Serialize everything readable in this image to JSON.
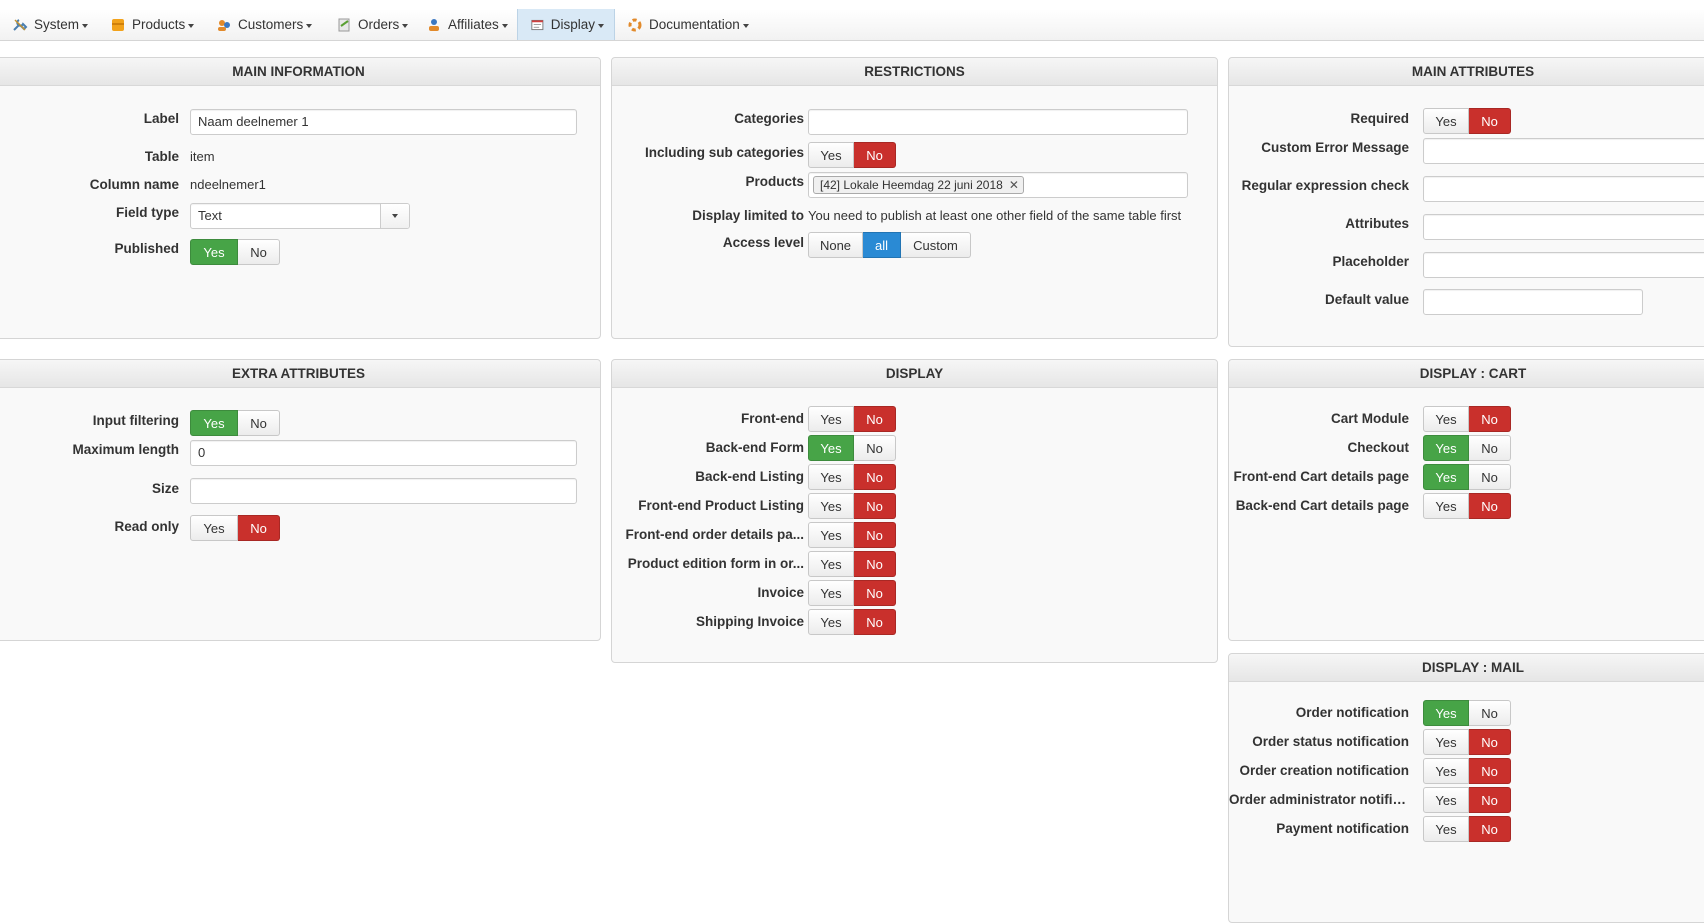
{
  "menu": [
    {
      "label": "System",
      "icon": "wrench-icon",
      "active": false
    },
    {
      "label": "Products",
      "icon": "products-icon",
      "active": false
    },
    {
      "label": "Customers",
      "icon": "customers-icon",
      "active": false
    },
    {
      "label": "Orders",
      "icon": "orders-icon",
      "active": false
    },
    {
      "label": "Affiliates",
      "icon": "affiliates-icon",
      "active": false
    },
    {
      "label": "Display",
      "icon": "display-icon",
      "active": true
    },
    {
      "label": "Documentation",
      "icon": "documentation-icon",
      "active": false
    }
  ],
  "main_info": {
    "title": "MAIN INFORMATION",
    "label_label": "Label",
    "label_value": "Naam deelnemer 1",
    "table_label": "Table",
    "table_value": "item",
    "column_label": "Column name",
    "column_value": "ndeelnemer1",
    "fieldtype_label": "Field type",
    "fieldtype_value": "Text",
    "published_label": "Published",
    "published_value": "Yes"
  },
  "restrictions": {
    "title": "RESTRICTIONS",
    "categories_label": "Categories",
    "categories_value": "",
    "subcat_label": "Including sub categories",
    "subcat_value": "No",
    "products_label": "Products",
    "products_tag": "[42] Lokale Heemdag 22 juni 2018",
    "display_limited_label": "Display limited to",
    "display_limited_value": "You need to publish at least one other field of the same table first",
    "access_label": "Access level",
    "access_options": [
      "None",
      "all",
      "Custom"
    ],
    "access_value": "all"
  },
  "main_attributes": {
    "title": "MAIN ATTRIBUTES",
    "required_label": "Required",
    "required_value": "No",
    "custom_error_label": "Custom Error Message",
    "regex_label": "Regular expression check",
    "attributes_label": "Attributes",
    "placeholder_label": "Placeholder",
    "default_label": "Default value"
  },
  "extra_attributes": {
    "title": "EXTRA ATTRIBUTES",
    "input_filtering_label": "Input filtering",
    "input_filtering_value": "Yes",
    "max_length_label": "Maximum length",
    "max_length_value": "0",
    "size_label": "Size",
    "size_value": "",
    "read_only_label": "Read only",
    "read_only_value": "No"
  },
  "display": {
    "title": "DISPLAY",
    "rows": [
      {
        "label": "Front-end",
        "value": "No"
      },
      {
        "label": "Back-end Form",
        "value": "Yes"
      },
      {
        "label": "Back-end Listing",
        "value": "No"
      },
      {
        "label": "Front-end Product Listing",
        "value": "No"
      },
      {
        "label": "Front-end order details pa...",
        "value": "No"
      },
      {
        "label": "Product edition form in or...",
        "value": "No"
      },
      {
        "label": "Invoice",
        "value": "No"
      },
      {
        "label": "Shipping Invoice",
        "value": "No"
      }
    ]
  },
  "display_cart": {
    "title": "DISPLAY : CART",
    "rows": [
      {
        "label": "Cart Module",
        "value": "No"
      },
      {
        "label": "Checkout",
        "value": "Yes"
      },
      {
        "label": "Front-end Cart details page",
        "value": "Yes"
      },
      {
        "label": "Back-end Cart details page",
        "value": "No"
      }
    ]
  },
  "display_mail": {
    "title": "DISPLAY : MAIL",
    "rows": [
      {
        "label": "Order notification",
        "value": "Yes"
      },
      {
        "label": "Order status notification",
        "value": "No"
      },
      {
        "label": "Order creation notification",
        "value": "No"
      },
      {
        "label": "Order administrator notific...",
        "value": "No"
      },
      {
        "label": "Payment notification",
        "value": "No"
      }
    ]
  },
  "yes_label": "Yes",
  "no_label": "No",
  "colors": {
    "red": "#c9302c",
    "green": "#47a447",
    "blue": "#2a8ad4",
    "active_menu": "#d9e9f6"
  }
}
